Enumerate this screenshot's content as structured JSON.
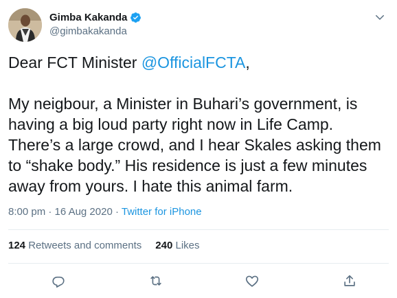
{
  "author": {
    "name": "Gimba Kakanda",
    "handle": "@gimbakakanda"
  },
  "tweet": {
    "line1_prefix": "Dear FCT Minister ",
    "mention": "@OfficialFCTA",
    "line1_suffix": ",",
    "body": "My neigbour, a Minister in Buhari’s government, is having a big loud party right now in Life Camp. There’s a large crowd, and I hear Skales asking them to “shake body.” His residence is just a few minutes away from yours. I hate this animal farm."
  },
  "meta": {
    "time": "8:00 pm",
    "separator1": " · ",
    "date": "16 Aug 2020",
    "separator2": " · ",
    "source": "Twitter for iPhone"
  },
  "stats": {
    "retweets_count": "124",
    "retweets_label": "Retweets and comments",
    "likes_count": "240",
    "likes_label": "Likes"
  },
  "icons": {
    "verified": "verified-badge-icon",
    "caret": "chevron-down-icon",
    "reply": "reply-icon",
    "retweet": "retweet-icon",
    "like": "heart-icon",
    "share": "share-icon"
  },
  "colors": {
    "accent": "#1b95e0",
    "muted": "#5b7083",
    "text": "#14171a"
  }
}
